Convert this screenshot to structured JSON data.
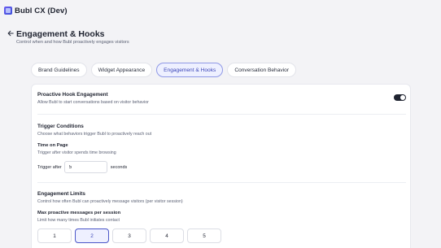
{
  "app": {
    "title": "Bubl CX (Dev)"
  },
  "header": {
    "title": "Engagement & Hooks",
    "subtitle": "Control when and how Bubl proactively engages visitors"
  },
  "tabs": [
    {
      "label": "Brand Guidelines",
      "active": false
    },
    {
      "label": "Widget Appearance",
      "active": false
    },
    {
      "label": "Engagement & Hooks",
      "active": true
    },
    {
      "label": "Conversation Behavior",
      "active": false
    }
  ],
  "proactive": {
    "title": "Proactive Hook Engagement",
    "description": "Allow Bubl to start conversations based on visitor behavior",
    "enabled": true
  },
  "triggers": {
    "title": "Trigger Conditions",
    "description": "Choose what behaviors trigger Bubl to proactively reach out",
    "time_on_page": {
      "label": "Time on Page",
      "description": "Trigger after visitor spends time browsing",
      "prefix": "Trigger after",
      "value": "5",
      "suffix": "seconds"
    }
  },
  "limits": {
    "title": "Engagement Limits",
    "description": "Control how often Bubl can proactively message visitors (per visitor session)",
    "max_messages": {
      "label": "Max proactive messages per session",
      "description": "Limit how many times Bubl initiates contact",
      "options": [
        "1",
        "2",
        "3",
        "4",
        "5"
      ],
      "selected": "2"
    }
  },
  "colors": {
    "accent": "#4a56c8",
    "accent_bg": "#eef0ff",
    "toggle_on": "#1f2330",
    "page_bg": "#f3f3f6"
  },
  "icons": {
    "back": "arrow-left-icon",
    "logo": "bubl-logo-icon"
  }
}
